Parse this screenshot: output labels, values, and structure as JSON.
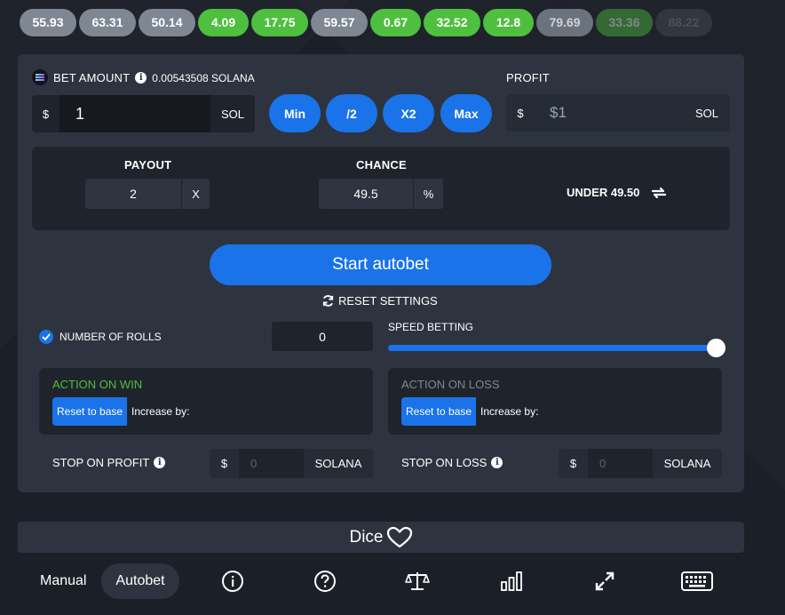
{
  "history": [
    {
      "value": "55.93",
      "tone": "gray"
    },
    {
      "value": "63.31",
      "tone": "gray"
    },
    {
      "value": "50.14",
      "tone": "gray"
    },
    {
      "value": "4.09",
      "tone": "green"
    },
    {
      "value": "17.75",
      "tone": "green"
    },
    {
      "value": "59.57",
      "tone": "gray"
    },
    {
      "value": "0.67",
      "tone": "green"
    },
    {
      "value": "32.52",
      "tone": "green"
    },
    {
      "value": "12.8",
      "tone": "green"
    },
    {
      "value": "79.69",
      "tone": "gray"
    },
    {
      "value": "33.36",
      "tone": "green"
    },
    {
      "value": "88.22",
      "tone": "gray"
    }
  ],
  "bet": {
    "label": "BET AMOUNT",
    "balance": "0.00543508 SOLANA",
    "currency_symbol": "$",
    "value": "1",
    "unit": "SOL",
    "buttons": {
      "min": "Min",
      "half": "/2",
      "double": "X2",
      "max": "Max"
    }
  },
  "profit": {
    "label": "PROFIT",
    "currency_symbol": "$",
    "value": "$1",
    "unit": "SOL"
  },
  "payout": {
    "label": "PAYOUT",
    "value": "2",
    "suffix": "X"
  },
  "chance": {
    "label": "CHANCE",
    "value": "49.5",
    "suffix": "%"
  },
  "under": {
    "label": "UNDER 49.50"
  },
  "start_button": "Start autobet",
  "reset_settings": "RESET SETTINGS",
  "rolls": {
    "label": "NUMBER OF ROLLS",
    "value": "0"
  },
  "speed": {
    "label": "SPEED BETTING",
    "level": 1.0
  },
  "win": {
    "title": "ACTION ON WIN",
    "reset": "Reset to base",
    "increase": "Increase by:"
  },
  "loss": {
    "title": "ACTION ON LOSS",
    "reset": "Reset to base",
    "increase": "Increase by:"
  },
  "stop_profit": {
    "label": "STOP ON PROFIT",
    "symbol": "$",
    "placeholder": "0",
    "unit": "SOLANA"
  },
  "stop_loss": {
    "label": "STOP ON LOSS",
    "symbol": "$",
    "placeholder": "0",
    "unit": "SOLANA"
  },
  "game_title": "Dice",
  "tabs": {
    "manual": "Manual",
    "autobet": "Autobet"
  },
  "colors": {
    "accent": "#1a73e8",
    "green": "#4fbf3f",
    "panel": "#2d343f"
  }
}
